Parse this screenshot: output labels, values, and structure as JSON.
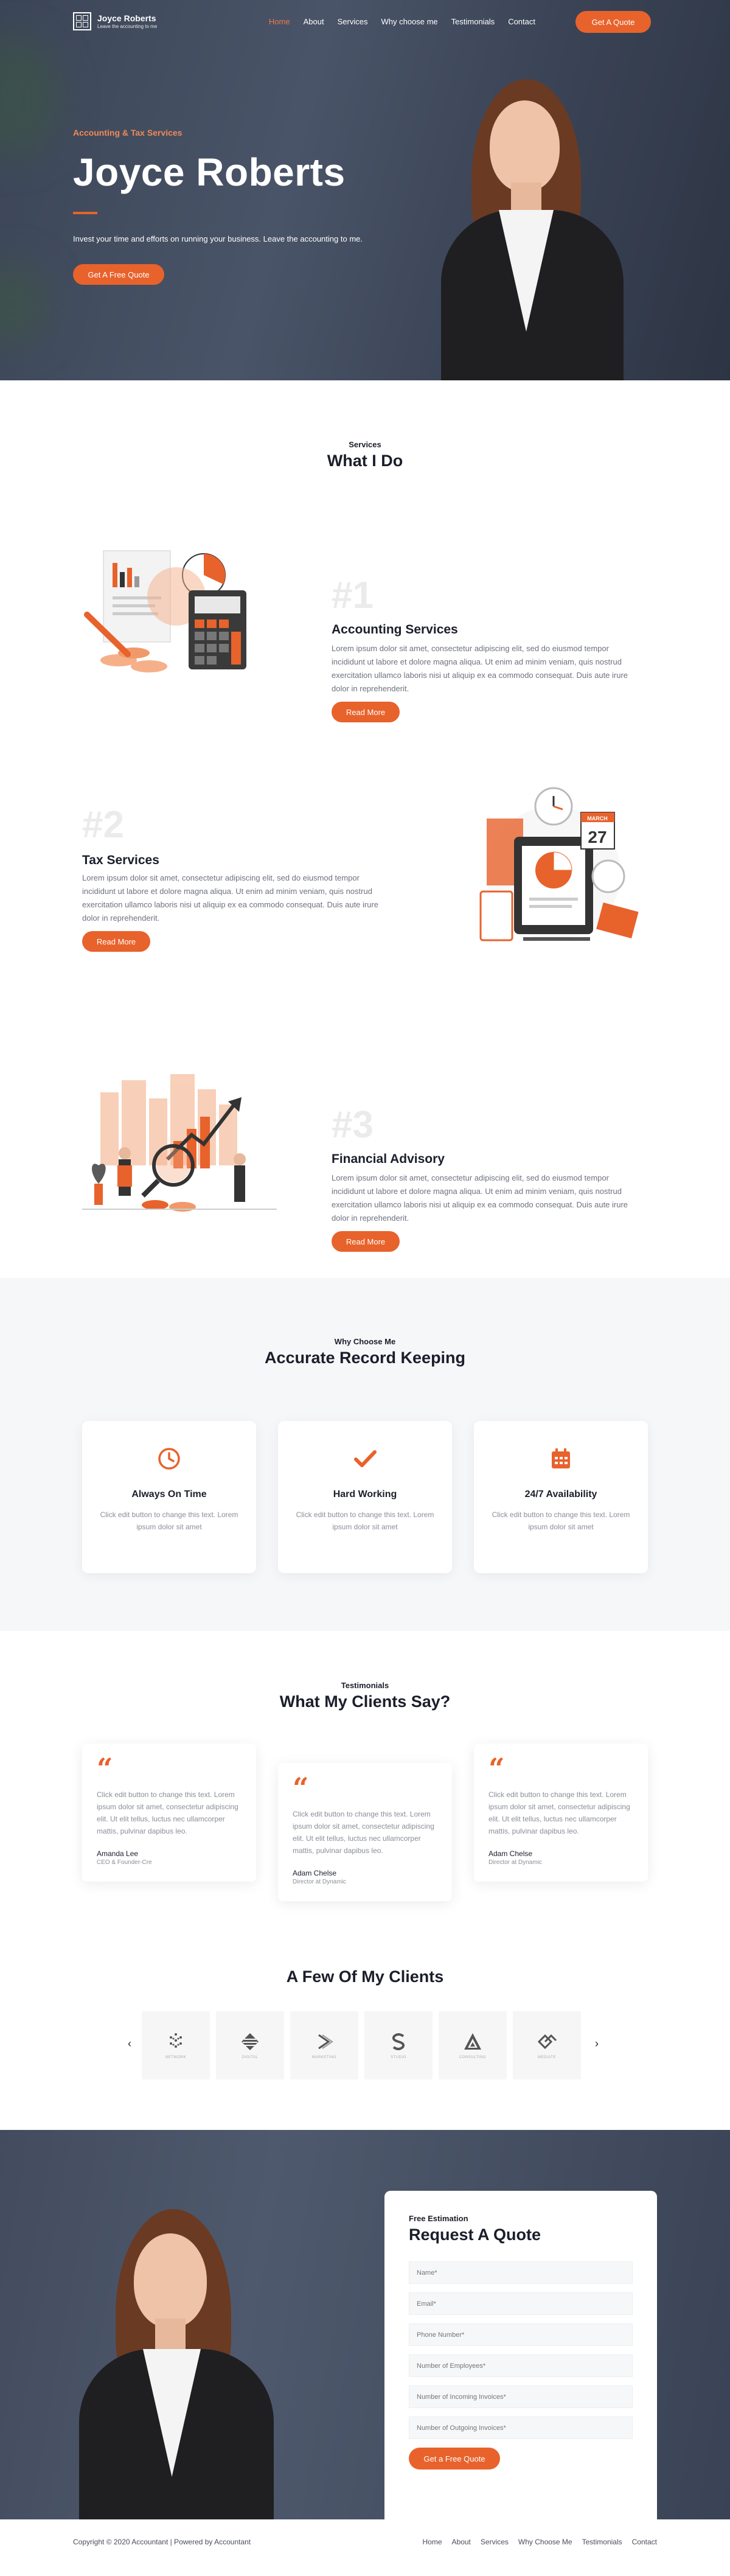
{
  "nav": {
    "brand_title": "Joyce Roberts",
    "brand_sub": "Leave the accounting to me",
    "links": [
      "Home",
      "About",
      "Services",
      "Why choose me",
      "Testimonials",
      "Contact"
    ],
    "cta": "Get A Quote"
  },
  "hero": {
    "eyebrow": "Accounting & Tax Services",
    "title": "Joyce Roberts",
    "tagline": "Invest your time and efforts on running your business. Leave the accounting to me.",
    "cta": "Get A Free Quote"
  },
  "services": {
    "eyebrow": "Services",
    "title": "What I Do",
    "items": [
      {
        "num": "#1",
        "title": "Accounting Services",
        "desc": "Lorem ipsum dolor sit amet, consectetur adipiscing elit, sed do eiusmod tempor incididunt ut labore et dolore magna aliqua. Ut enim ad minim veniam, quis nostrud exercitation ullamco laboris nisi ut aliquip ex ea commodo consequat. Duis aute irure dolor in reprehenderit.",
        "button": "Read More"
      },
      {
        "num": "#2",
        "title": "Tax Services",
        "desc": "Lorem ipsum dolor sit amet, consectetur adipiscing elit, sed do eiusmod tempor incididunt ut labore et dolore magna aliqua. Ut enim ad minim veniam, quis nostrud exercitation ullamco laboris nisi ut aliquip ex ea commodo consequat. Duis aute irure dolor in reprehenderit.",
        "button": "Read More"
      },
      {
        "num": "#3",
        "title": "Financial Advisory",
        "desc": "Lorem ipsum dolor sit amet, consectetur adipiscing elit, sed do eiusmod tempor incididunt ut labore et dolore magna aliqua. Ut enim ad minim veniam, quis nostrud exercitation ullamco laboris nisi ut aliquip ex ea commodo consequat. Duis aute irure dolor in reprehenderit.",
        "button": "Read More"
      }
    ],
    "calendar_label": "MARCH",
    "calendar_day": "27"
  },
  "why": {
    "eyebrow": "Why Choose Me",
    "title": "Accurate Record Keeping",
    "cards": [
      {
        "icon": "clock-icon",
        "title": "Always On Time",
        "desc": "Click edit button to change this text. Lorem ipsum dolor sit amet"
      },
      {
        "icon": "checkmark-icon",
        "title": "Hard Working",
        "desc": "Click edit button to change this text. Lorem ipsum dolor sit amet"
      },
      {
        "icon": "calendar-icon",
        "title": "24/7 Availability",
        "desc": "Click edit button to change this text. Lorem ipsum dolor sit amet"
      }
    ]
  },
  "testimonials": {
    "eyebrow": "Testimonials",
    "title": "What My Clients Say?",
    "items": [
      {
        "text": "Click edit button to change this text. Lorem ipsum dolor sit amet, consectetur adipiscing elit. Ut elit tellus, luctus nec ullamcorper mattis, pulvinar dapibus leo.",
        "name": "Amanda Lee",
        "role": "CEO & Founder-Cre"
      },
      {
        "text": "Click edit button to change this text. Lorem ipsum dolor sit amet, consectetur adipiscing elit. Ut elit tellus, luctus nec ullamcorper mattis, pulvinar dapibus leo.",
        "name": "Adam Chelse",
        "role": "Director at Dynamic"
      },
      {
        "text": "Click edit button to change this text. Lorem ipsum dolor sit amet, consectetur adipiscing elit. Ut elit tellus, luctus nec ullamcorper mattis, pulvinar dapibus leo.",
        "name": "Adam Chelse",
        "role": "Director at Dynamic"
      }
    ]
  },
  "clients": {
    "title": "A Few Of My Clients",
    "logos": [
      "NETWORK",
      "DIGITAL",
      "MARKETING",
      "STUDIO",
      "CONSULTING",
      "MEDIATE"
    ],
    "prev": "‹",
    "next": "›"
  },
  "quote": {
    "eyebrow": "Free Estimation",
    "title": "Request A Quote",
    "fields": [
      "Name*",
      "Email*",
      "Phone Number*",
      "Number of Employees*",
      "Number of Incoming Invoices*",
      "Number of Outgoing Invoices*"
    ],
    "button": "Get a Free Quote"
  },
  "footer": {
    "copyright": "Copyright © 2020 Accountant | Powered by Accountant",
    "links": [
      "Home",
      "About",
      "Services",
      "Why Choose Me",
      "Testimonials",
      "Contact"
    ]
  },
  "colors": {
    "accent": "#e8622c",
    "dark": "#1b1e2b",
    "hero_bg": "#3b4557"
  }
}
